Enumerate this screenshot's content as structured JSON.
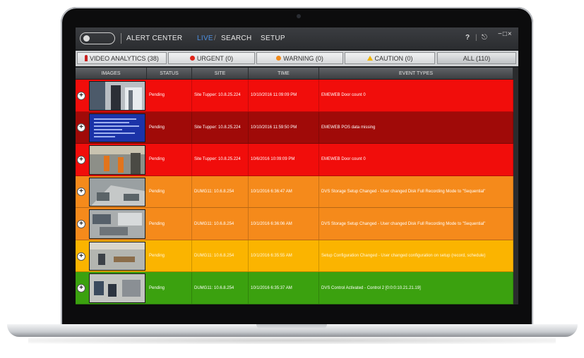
{
  "titlebar": {
    "app_name": "ALERT CENTER",
    "nav": {
      "live": "LIVE",
      "slash": "/",
      "search": "SEARCH",
      "setup": "SETUP"
    },
    "icons": {
      "help": "?",
      "divider": "|",
      "exit": "⎋",
      "window": "−□×"
    }
  },
  "tabs": [
    {
      "label": "VIDEO ANALYTICS (38)",
      "icon": "pin-icon",
      "color": "#c92121"
    },
    {
      "label": "URGENT (0)",
      "icon": "red-dot-icon",
      "color": "#e0261b"
    },
    {
      "label": "WARNING (0)",
      "icon": "orange-dot-icon",
      "color": "#f08a1c"
    },
    {
      "label": "CAUTION (0)",
      "icon": "triangle-icon",
      "color": "#f0b400"
    },
    {
      "label": "ALL (110)",
      "icon": "",
      "color": ""
    }
  ],
  "columns": [
    "IMAGES",
    "STATUS",
    "SITE",
    "TIME",
    "EVENT TYPES"
  ],
  "rows": [
    {
      "color": "#f10d0b",
      "status": "Pending",
      "site": "Site Tupper: 10.8.25.224",
      "time": "10/10/2016 11:09:09 PM",
      "event": "EMEWEB Door count 0"
    },
    {
      "color": "#a00a08",
      "status": "Pending",
      "site": "Site Tupper: 10.8.25.224",
      "time": "10/10/2016 11:59:50 PM",
      "event": "EMEWEB POS data missing"
    },
    {
      "color": "#f10d0b",
      "status": "Pending",
      "site": "Site Tupper: 10.8.25.224",
      "time": "10/6/2016 10:09:09 PM",
      "event": "EMEWEB Door count 0"
    },
    {
      "color": "#f58a1b",
      "status": "Pending",
      "site": "DUMG11: 10.6.8.254",
      "time": "10/1/2016 6:36:47 AM",
      "event": "DVS Storage Setup Changed - User changed Disk Full Recording Mode to \"Sequential\""
    },
    {
      "color": "#f58a1b",
      "status": "Pending",
      "site": "DUMG11: 10.6.8.254",
      "time": "10/1/2016 6:36:06 AM",
      "event": "DVS Storage Setup Changed - User changed Disk Full Recording Mode to \"Sequential\""
    },
    {
      "color": "#fbb400",
      "status": "Pending",
      "site": "DUMG11: 10.6.8.254",
      "time": "10/1/2016 6:35:55 AM",
      "event": "Setup Configuration Changed - User changed configuration on setup (record, schedule)"
    },
    {
      "color": "#3ba10f",
      "status": "Pending",
      "site": "DUMG11: 10.6.8.254",
      "time": "10/1/2016 6:35:37 AM",
      "event": "DVS Control Activated - Control 2 [0:0:0:10.21.21.19]"
    }
  ]
}
